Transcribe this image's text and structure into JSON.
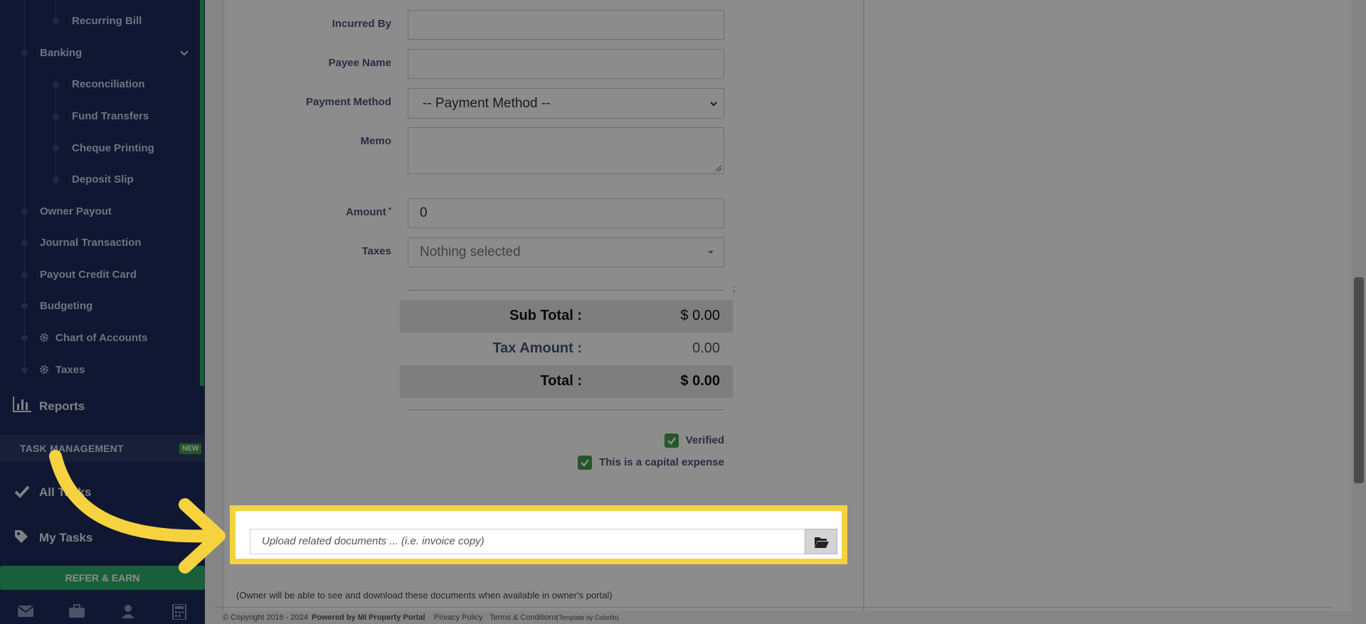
{
  "sidebar": {
    "items": [
      {
        "label": "Recurring Bill"
      },
      {
        "label": "Banking"
      },
      {
        "label": "Reconciliation"
      },
      {
        "label": "Fund Transfers"
      },
      {
        "label": "Cheque Printing"
      },
      {
        "label": "Deposit Slip"
      },
      {
        "label": "Owner Payout"
      },
      {
        "label": "Journal Transaction"
      },
      {
        "label": "Payout Credit Card"
      },
      {
        "label": "Budgeting"
      },
      {
        "label": "Chart of Accounts"
      },
      {
        "label": "Taxes"
      }
    ],
    "reports_label": "Reports",
    "task_management": {
      "label": "TASK MANAGEMENT",
      "badge": "NEW"
    },
    "all_tasks_label": "All Tasks",
    "my_tasks_label": "My Tasks",
    "refer_label": "REFER & EARN"
  },
  "form": {
    "incurred_by_label": "Incurred By",
    "payee_name_label": "Payee Name",
    "payment_method_label": "Payment Method",
    "payment_method_value": "-- Payment Method --",
    "memo_label": "Memo",
    "amount_label": "Amount",
    "amount_required": "*",
    "amount_value": "0",
    "taxes_label": "Taxes",
    "taxes_value": "Nothing selected",
    "separator_mark": ";"
  },
  "totals": {
    "subtotal_label": "Sub Total :",
    "subtotal_value": "$ 0.00",
    "tax_label": "Tax Amount :",
    "tax_value": "0.00",
    "total_label": "Total :",
    "total_value": "$ 0.00"
  },
  "checks": {
    "verified_label": "Verified",
    "capital_label": "This is a capital expense"
  },
  "upload": {
    "placeholder": "Upload related documents ... (i.e. invoice copy)"
  },
  "note": "(Owner will be able to see and download these documents when available in owner's portal)",
  "footer": {
    "copyright": "© Copyright 2016 - 2024",
    "powered": "Powered by MI Property Portal",
    "privacy": "Privacy Policy",
    "terms": "Terms & Conditions",
    "template": "(Template by Colorlib)"
  },
  "colors": {
    "sidebar_bg": "#1c2a5c",
    "accent_green": "#2fae6a",
    "highlight": "#f6d23f"
  }
}
